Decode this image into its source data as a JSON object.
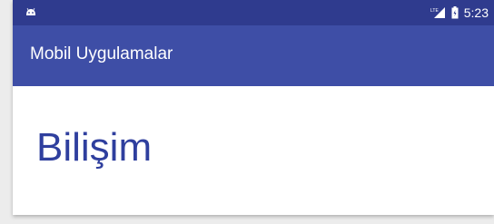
{
  "status_bar": {
    "time": "5:23",
    "network_label": "LTE",
    "icons": [
      "android-icon",
      "signal-icon",
      "battery-icon"
    ],
    "color": "#2f3b8e"
  },
  "app_bar": {
    "title": "Mobil Uygulamalar",
    "color": "#3e4ea6"
  },
  "content": {
    "text": "Bilişim",
    "text_color": "#2f3f9e"
  }
}
